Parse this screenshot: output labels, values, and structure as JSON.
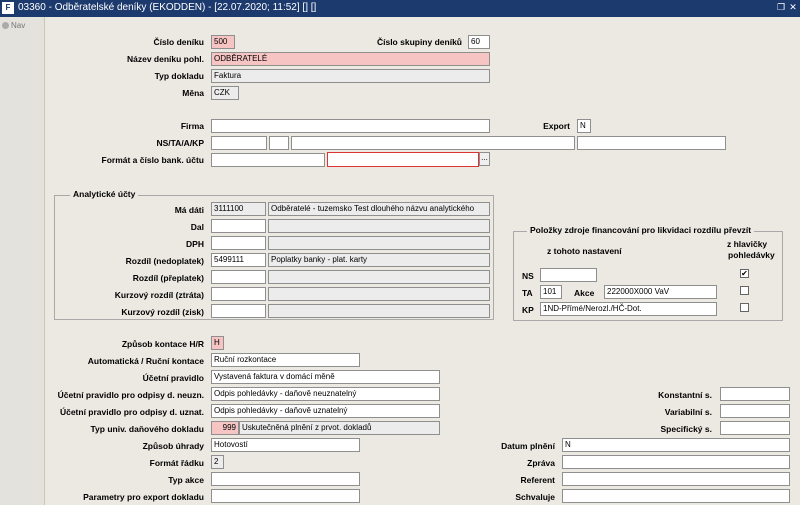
{
  "window": {
    "title": "03360 - Odběratelské deníky (EKODDEN) - [22.07.2020; 11:52] [] []",
    "restore_icon": "restore-icon",
    "close_icon": "close-icon"
  },
  "nav": {
    "tab_label": "Nav"
  },
  "header": {
    "cislo_deniku_label": "Číslo deníku",
    "cislo_deniku": "500",
    "cislo_skupiny_label": "Číslo skupiny deníků",
    "cislo_skupiny": "60",
    "nazev_label": "Název deníku pohl.",
    "nazev": "ODBĚRATELÉ",
    "typ_dokladu_label": "Typ dokladu",
    "typ_dokladu": "Faktura",
    "mena_label": "Měna",
    "mena": "CZK"
  },
  "firma": {
    "firma_label": "Firma",
    "firma": "",
    "export_label": "Export",
    "export": "N",
    "ns_label": "NS/TA/A/KP",
    "format_label": "Formát a číslo bank. účtu",
    "format_btn": "..."
  },
  "analyticke": {
    "title": "Analytické účty",
    "rows": [
      {
        "label": "Má dáti",
        "code": "3111100",
        "desc": "Odběratelé - tuzemsko Test dlouhého názvu analytického"
      },
      {
        "label": "Dal",
        "code": "",
        "desc": ""
      },
      {
        "label": "DPH",
        "code": "",
        "desc": ""
      },
      {
        "label": "Rozdíl (nedoplatek)",
        "code": "5499111",
        "desc": "Poplatky banky - plat. karty"
      },
      {
        "label": "Rozdíl (přeplatek)",
        "code": "",
        "desc": ""
      },
      {
        "label": "Kurzový rozdíl (ztráta)",
        "code": "",
        "desc": ""
      },
      {
        "label": "Kurzový rozdíl (zisk)",
        "code": "",
        "desc": ""
      }
    ]
  },
  "polozky": {
    "title": "Položky zdroje financování pro likvidaci rozdílu převzít",
    "col1": "z tohoto nastavení",
    "col2a": "z hlavičky",
    "col2b": "pohledávky",
    "ns_label": "NS",
    "ns": "",
    "ta_label": "TA",
    "ta": "101",
    "akce_label": "Akce",
    "akce": "222000X000 VaV",
    "kp_label": "KP",
    "kp": "1ND-Přímé/Nerozl./HČ-Dot.",
    "chk_ns": "✔",
    "chk_ta": "",
    "chk_kp": ""
  },
  "kontace": {
    "zpusob_label": "Způsob kontace H/R",
    "zpusob": "H",
    "auto_label": "Automatická / Ruční kontace",
    "auto": "Ruční rozkontace",
    "ucetni_label": "Účetní pravidlo",
    "ucetni": "Vystavená faktura v domácí měně",
    "neuzn_label": "Účetní pravidlo pro odpisy d. neuzn.",
    "neuzn": "Odpis pohledávky - daňově neuznatelný",
    "uzn_label": "Účetní pravidlo pro odpisy d. uznat.",
    "uzn": "Odpis pohledávky - daňově uznatelný",
    "typ_univ_label": "Typ univ. daňového dokladu",
    "typ_univ_code": "999",
    "typ_univ": "Uskutečněná plnění z prvot. dokladů",
    "zpusob_uhrady_label": "Způsob úhrady",
    "zpusob_uhrady": "Hotovostí",
    "format_radku_label": "Formát řádku",
    "format_radku": "2",
    "typ_akce_label": "Typ akce",
    "typ_akce": "",
    "param_label": "Parametry pro export dokladu",
    "param": ""
  },
  "symbols": {
    "konst_label": "Konstantní s.",
    "konst": "",
    "var_label": "Variabilní s.",
    "var": "",
    "spec_label": "Specifický s.",
    "spec": "",
    "datum_label": "Datum plnění",
    "datum": "N",
    "zprava_label": "Zpráva",
    "zprava": "",
    "referent_label": "Referent",
    "referent": "",
    "schvaluje_label": "Schvaluje",
    "schvaluje": ""
  }
}
